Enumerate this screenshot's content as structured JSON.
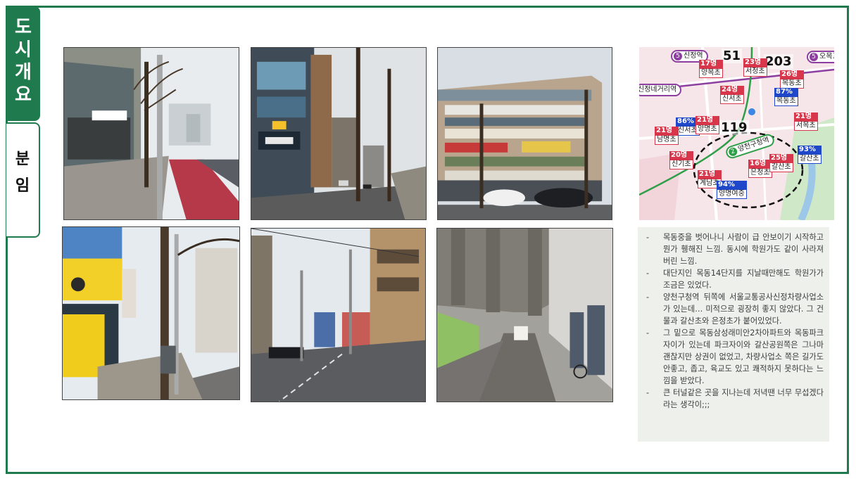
{
  "tabs": [
    {
      "label": "도시개요",
      "active": true
    },
    {
      "label": "분임",
      "active": false
    }
  ],
  "photos": [
    {
      "name": "photo-street-bike-lane",
      "icon": "street-photo"
    },
    {
      "name": "photo-study-cafe-street",
      "icon": "street-photo"
    },
    {
      "name": "photo-commercial-building",
      "icon": "street-photo"
    },
    {
      "name": "photo-coffee-shop-corner",
      "icon": "street-photo"
    },
    {
      "name": "photo-intersection",
      "icon": "street-photo"
    },
    {
      "name": "photo-overpass-underpass",
      "icon": "street-photo"
    }
  ],
  "map": {
    "stations": [
      {
        "num": "5",
        "label": "신정역"
      },
      {
        "num": "5",
        "label": "오목교"
      },
      {
        "num": "",
        "label": "신정네거리역"
      },
      {
        "num": "2",
        "label": "양천구청역"
      }
    ],
    "big_numbers": [
      "51",
      "203",
      "119"
    ],
    "tags": [
      {
        "value": "17명",
        "name": "양목초"
      },
      {
        "value": "23명",
        "name": "서정초"
      },
      {
        "value": "26명",
        "name": "목동초"
      },
      {
        "value": "24명",
        "name": "신서초"
      },
      {
        "value": "87%",
        "name": "목동초"
      },
      {
        "value": "86%",
        "name": "신서초"
      },
      {
        "value": "21명",
        "name": "양명초"
      },
      {
        "value": "21명",
        "name": "서목초"
      },
      {
        "value": "21명",
        "name": "남명초"
      },
      {
        "value": "20명",
        "name": "신기초"
      },
      {
        "value": "16명",
        "name": "은정초"
      },
      {
        "value": "25명",
        "name": "갈산초"
      },
      {
        "value": "93%",
        "name": "갈산초"
      },
      {
        "value": "21명",
        "name": "계남초"
      },
      {
        "value": "94%",
        "name": "양명여중"
      }
    ],
    "colors": {
      "red_tag": "#d8364a",
      "blue_tag": "#1f47c9",
      "green_line": "#2e9e48",
      "purple_line": "#8c3fa0"
    }
  },
  "notes": [
    "목동중을 벗어나니 사람이 급 안보이기 시작하고 뭔가 휑해진 느낌. 동시에 학원가도 같이 사라져 버린 느낌.",
    "대단지인 목동14단지를 지날때만해도 학원가가 조금은 있었다.",
    "양천구청역 뒤쪽에 서울교통공사신정차량사업소가 있는데… 미적으로 굉장히 좋지 않았다. 그 건물과 갈산초와 은정초가 붙어있었다.",
    "그 밑으로 목동삼성래미안2차아파트와 목동파크자이가 있는데 파크자이와 갈산공원쪽은 그나마 괜찮지만 상권이 없었고, 차량사업소 쪽은 길가도 안좋고, 좁고, 육교도 있고 쾌적하지 못하다는 느낌을 받았다.",
    "큰 터널같은 곳을 지나는데 저녁땐 너무 무섭겠다라는 생각이;;;"
  ],
  "note_bullet": "-",
  "theme": {
    "primary": "#1f7a4d",
    "note_bg": "#eef0ec"
  }
}
